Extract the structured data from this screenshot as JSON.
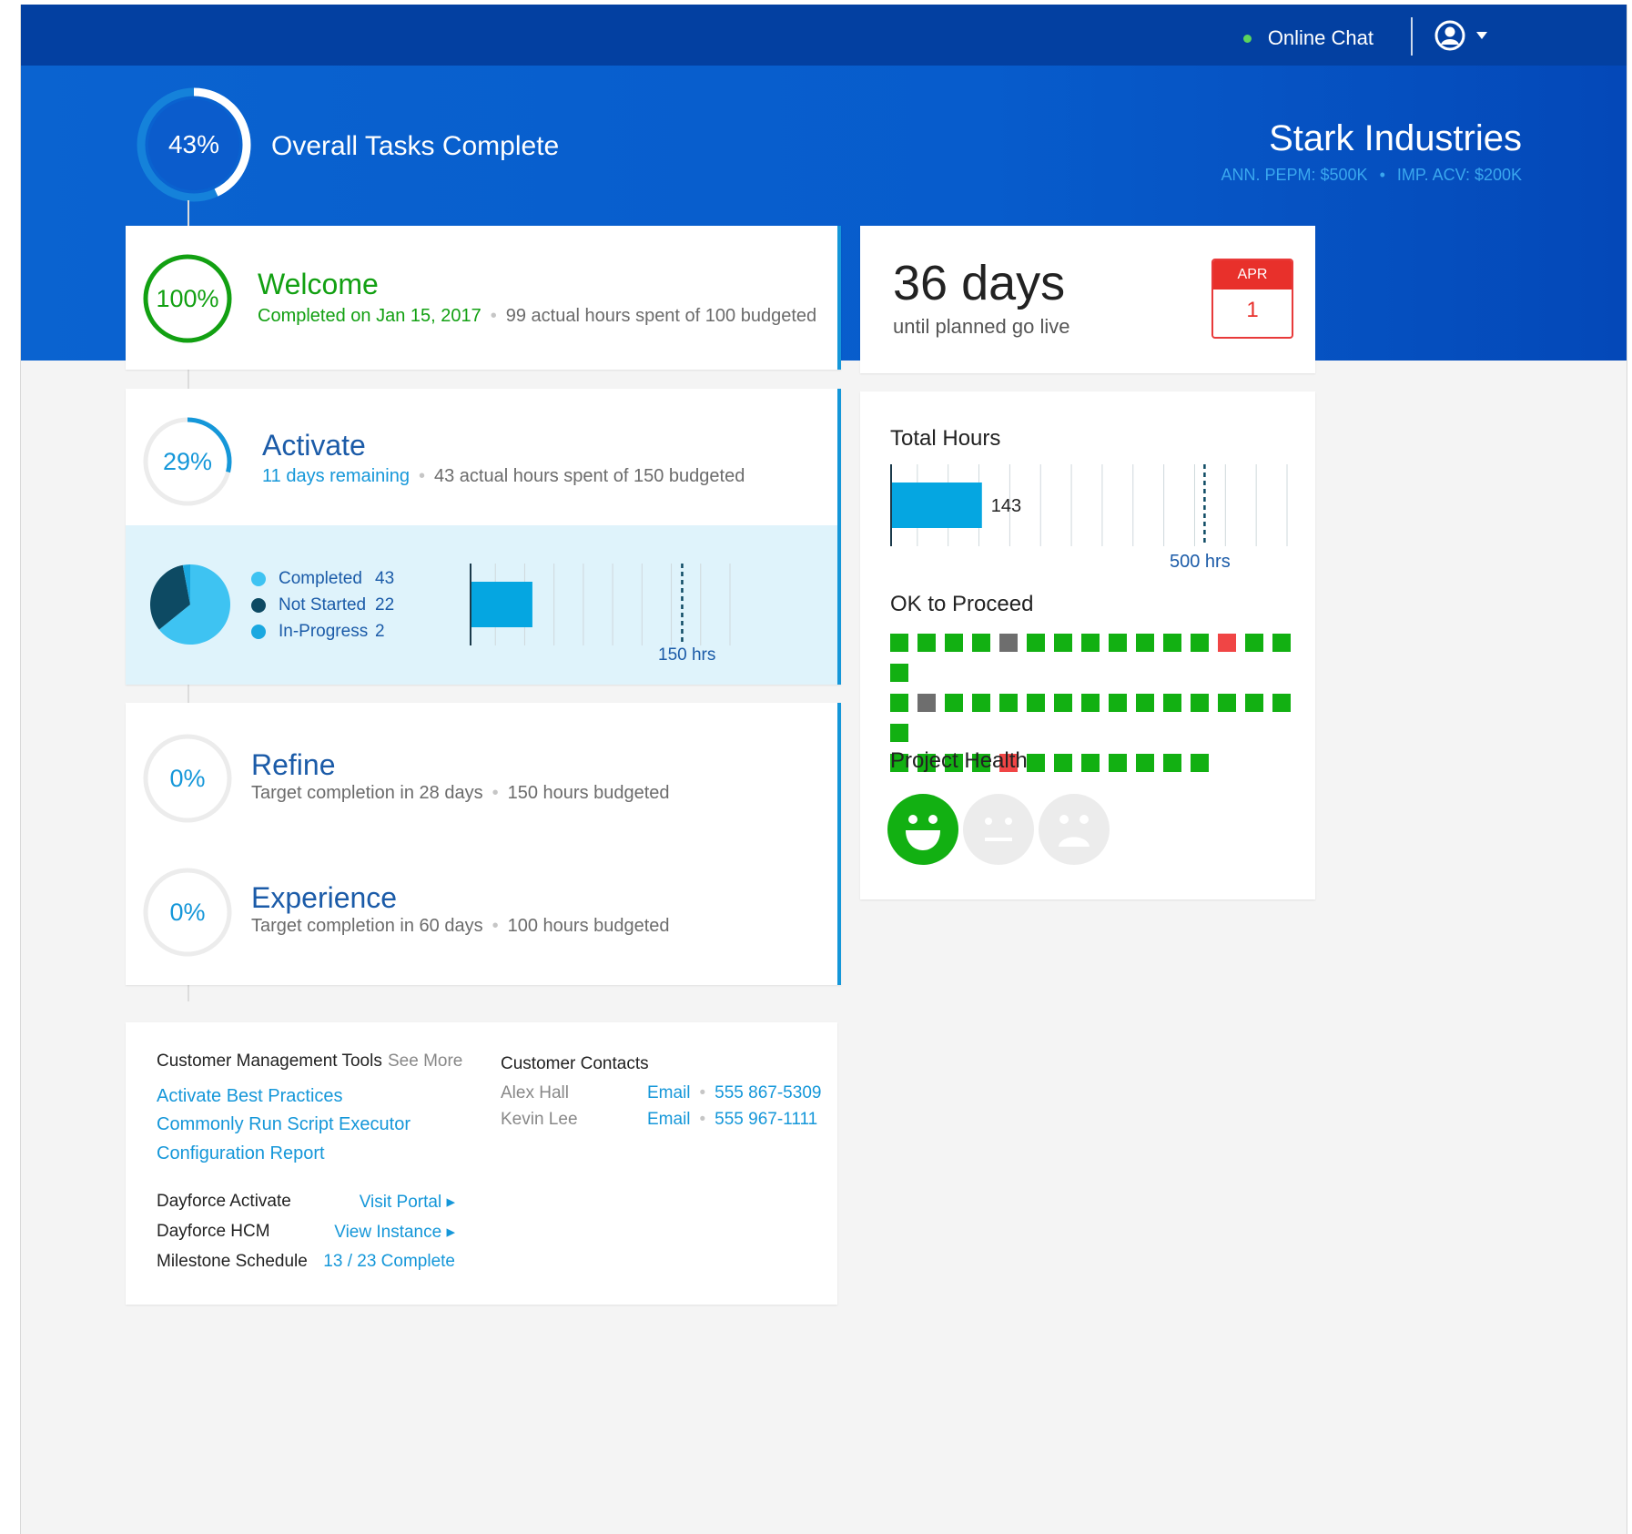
{
  "topbar": {
    "chat_label": "Online Chat"
  },
  "hero": {
    "overall_percent_label": "43%",
    "overall_fraction": 0.43,
    "overall_label": "Overall Tasks Complete",
    "company": "Stark Industries",
    "company_meta_1": "ANN. PEPM: $500K",
    "company_meta_2": "IMP. ACV: $200K",
    "meta_separator": "•"
  },
  "stages": {
    "welcome": {
      "percent_label": "100%",
      "fraction": 1.0,
      "title": "Welcome",
      "status": "Completed on Jan 15, 2017",
      "detail": "99 actual hours spent of 100 budgeted"
    },
    "activate": {
      "percent_label": "29%",
      "fraction": 0.29,
      "title": "Activate",
      "status": "11 days remaining",
      "detail": "43 actual hours spent of 150 budgeted"
    },
    "refine": {
      "percent_label": "0%",
      "fraction": 0,
      "title": "Refine",
      "status": "Target completion in 28 days",
      "detail": "150 hours budgeted"
    },
    "experience": {
      "percent_label": "0%",
      "fraction": 0,
      "title": "Experience",
      "status": "Target completion in 60 days",
      "detail": "100 hours budgeted"
    }
  },
  "activate_breakdown": {
    "legend": [
      {
        "label": "Completed",
        "value": "43",
        "color": "#3ec3f2"
      },
      {
        "label": "Not Started",
        "value": "22",
        "color": "#0d4a63"
      },
      {
        "label": "In-Progress",
        "value": "2",
        "color": "#1aa8e0"
      }
    ],
    "pie_values": [
      43,
      22,
      2
    ],
    "hours_actual": 43,
    "hours_budget": 150,
    "budget_label": "150 hrs"
  },
  "golive": {
    "days": "36 days",
    "subtitle": "until planned go live",
    "month": "APR",
    "day": "1"
  },
  "total_hours": {
    "title": "Total Hours",
    "value_label": "143",
    "actual": 143,
    "budget": 500,
    "budget_label": "500 hrs"
  },
  "proceed": {
    "title": "OK to Proceed",
    "rows": [
      [
        "g",
        "g",
        "g",
        "g",
        "x",
        "g",
        "g",
        "g",
        "g",
        "g",
        "g",
        "g",
        "r",
        "g",
        "g",
        "g"
      ],
      [
        "g",
        "x",
        "g",
        "g",
        "g",
        "g",
        "g",
        "g",
        "g",
        "g",
        "g",
        "g",
        "g",
        "g",
        "g",
        "g"
      ],
      [
        "g",
        "g",
        "g",
        "g",
        "r",
        "g",
        "g",
        "g",
        "g",
        "g",
        "g",
        "g"
      ]
    ],
    "colors": {
      "g": "#12b012",
      "x": "#6e6e6e",
      "r": "#f04545"
    }
  },
  "health": {
    "title": "Project Health",
    "state": "happy"
  },
  "tools": {
    "title": "Customer Management Tools",
    "see_more": "See More",
    "links": [
      "Activate Best Practices",
      "Commonly Run Script Executor",
      "Configuration Report"
    ],
    "rows": [
      {
        "label": "Dayforce Activate",
        "action": "Visit Portal ▸"
      },
      {
        "label": "Dayforce HCM",
        "action": "View Instance ▸"
      },
      {
        "label": "Milestone Schedule",
        "action": "13 / 23 Complete"
      }
    ]
  },
  "contacts": {
    "title": "Customer Contacts",
    "people": [
      {
        "name": "Alex Hall",
        "email": "Email",
        "phone": "555 867-5309"
      },
      {
        "name": "Kevin Lee",
        "email": "Email",
        "phone": "555 967-1111"
      }
    ],
    "separator": "•"
  }
}
